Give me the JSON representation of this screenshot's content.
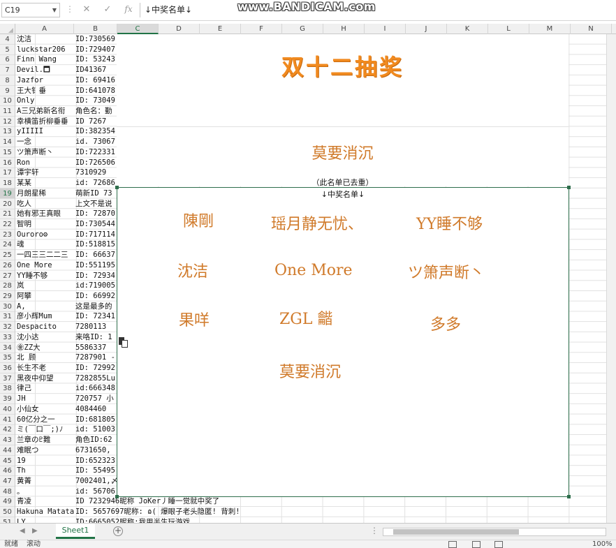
{
  "watermark": "www.BANDICAM.com",
  "formula_bar": {
    "name_box": "C19",
    "cancel": "✕",
    "confirm": "✓",
    "fx": "fx",
    "formula": "↓中奖名单↓"
  },
  "columns": [
    "A",
    "B",
    "C",
    "D",
    "E",
    "F",
    "G",
    "H",
    "I",
    "J",
    "K",
    "L",
    "M",
    "N"
  ],
  "selected_column": "C",
  "selected_row": 19,
  "rows": [
    {
      "n": "4",
      "a": "沈洁",
      "b": "ID:730569"
    },
    {
      "n": "5",
      "a": "luckstar206",
      "b": "ID:729407"
    },
    {
      "n": "6",
      "a": "Finn Wang",
      "b": "ID: 53243"
    },
    {
      "n": "7",
      "a": "Devil.🗖",
      "b": "ID41367"
    },
    {
      "n": "8",
      "a": "Jazfor",
      "b": "ID: 69416"
    },
    {
      "n": "9",
      "a": "王大钅垂",
      "b": "ID:641078"
    },
    {
      "n": "10",
      "a": "Only",
      "b": "ID: 73049"
    },
    {
      "n": "11",
      "a": "A三兄弟新名衔",
      "b": "角色名：勤"
    },
    {
      "n": "12",
      "a": "幸横笛折柳垂垂",
      "b": "ID   7267"
    },
    {
      "n": "13",
      "a": "yIIIII",
      "b": "ID:382354"
    },
    {
      "n": "14",
      "a": "一念",
      "b": "id. 73067"
    },
    {
      "n": "15",
      "a": "ツ箫声断丶",
      "b": "ID:722331"
    },
    {
      "n": "16",
      "a": "Ron",
      "b": "ID:726506"
    },
    {
      "n": "17",
      "a": "谭宇轩",
      "b": "7310929"
    },
    {
      "n": "18",
      "a": "某某",
      "b": "id: 72686"
    },
    {
      "n": "19",
      "a": "月朗星稀",
      "b": "萌新ID 73"
    },
    {
      "n": "20",
      "a": "吃人",
      "b": "上文不是说"
    },
    {
      "n": "21",
      "a": "她有邪王真眼",
      "b": "ID: 72870"
    },
    {
      "n": "22",
      "a": "智明",
      "b": "ID:730544"
    },
    {
      "n": "23",
      "a": "Ouroro⚙",
      "b": "ID:717114"
    },
    {
      "n": "24",
      "a": "魂",
      "b": "ID:518815"
    },
    {
      "n": "25",
      "a": "一四三三二二三",
      "b": "ID: 66637"
    },
    {
      "n": "26",
      "a": "One More",
      "b": "ID:551195"
    },
    {
      "n": "27",
      "a": "YY睡不够",
      "b": "ID: 72934"
    },
    {
      "n": "28",
      "a": "岚",
      "b": "id:719005"
    },
    {
      "n": "29",
      "a": "阿攀",
      "b": "ID: 66992"
    },
    {
      "n": "30",
      "a": "A,",
      "b": "这是最多的"
    },
    {
      "n": "31",
      "a": "彦小辉Mum",
      "b": "ID: 72341"
    },
    {
      "n": "32",
      "a": "Despacito",
      "b": "7280113"
    },
    {
      "n": "33",
      "a": "沈小达",
      "b": "来咯ID: 1"
    },
    {
      "n": "34",
      "a": "㊎ZZ大",
      "b": "5586337"
    },
    {
      "n": "35",
      "a": "北 顾",
      "b": "7287901 -"
    },
    {
      "n": "36",
      "a": "长生不老",
      "b": "ID: 72992"
    },
    {
      "n": "37",
      "a": "黑夜中仰望",
      "b": "7282855Lu"
    },
    {
      "n": "38",
      "a": "律己",
      "b": "id:666348"
    },
    {
      "n": "39",
      "a": "JH",
      "b": "720757 小"
    },
    {
      "n": "40",
      "a": "小仙女",
      "b": "4084460"
    },
    {
      "n": "41",
      "a": "60亿分之一",
      "b": "ID:681805"
    },
    {
      "n": "42",
      "a": "ミ(￣口￣;)ﾉ",
      "b": "id: 51003"
    },
    {
      "n": "43",
      "a": "兰章の♇難",
      "b": "角色ID:62"
    },
    {
      "n": "44",
      "a": "难眠つ",
      "b": "6731650,"
    },
    {
      "n": "45",
      "a": "19",
      "b": "ID:652323"
    },
    {
      "n": "46",
      "a": "Th",
      "b": "ID: 55495"
    },
    {
      "n": "47",
      "a": "黄菁",
      "b": "7002401,〆"
    },
    {
      "n": "48",
      "a": "。",
      "b": "id: 56706"
    },
    {
      "n": "49",
      "a": "青凌",
      "b": "ID 7232946昵称 JoKer丿睡一觉就中奖了"
    },
    {
      "n": "50",
      "a": "Hakuna Matata",
      "b": "ID: 5657697昵称: ɷ( 爆眼子老头隐匿! 背刺!"
    },
    {
      "n": "51",
      "a": "LY",
      "b": "ID:6665052昵称:我用半生玩游戏"
    }
  ],
  "title_shape": {
    "title": "双十二抽奖",
    "featured_name": "莫要消沉",
    "note": "（此名单已去重）"
  },
  "winners_box": {
    "label": "↓中奖名单↓",
    "names": [
      "陳剛",
      "瑶月静无忧、",
      "YY睡不够",
      "沈洁",
      "One More",
      "ツ箫声断丶",
      "果咩",
      "ZGL 龤",
      "多多",
      "莫要消沉"
    ]
  },
  "sheet_tabs": {
    "active": "Sheet1",
    "add": "+"
  },
  "status_bar": {
    "left1": "就绪",
    "left2": "滚动",
    "zoom": "100%"
  }
}
